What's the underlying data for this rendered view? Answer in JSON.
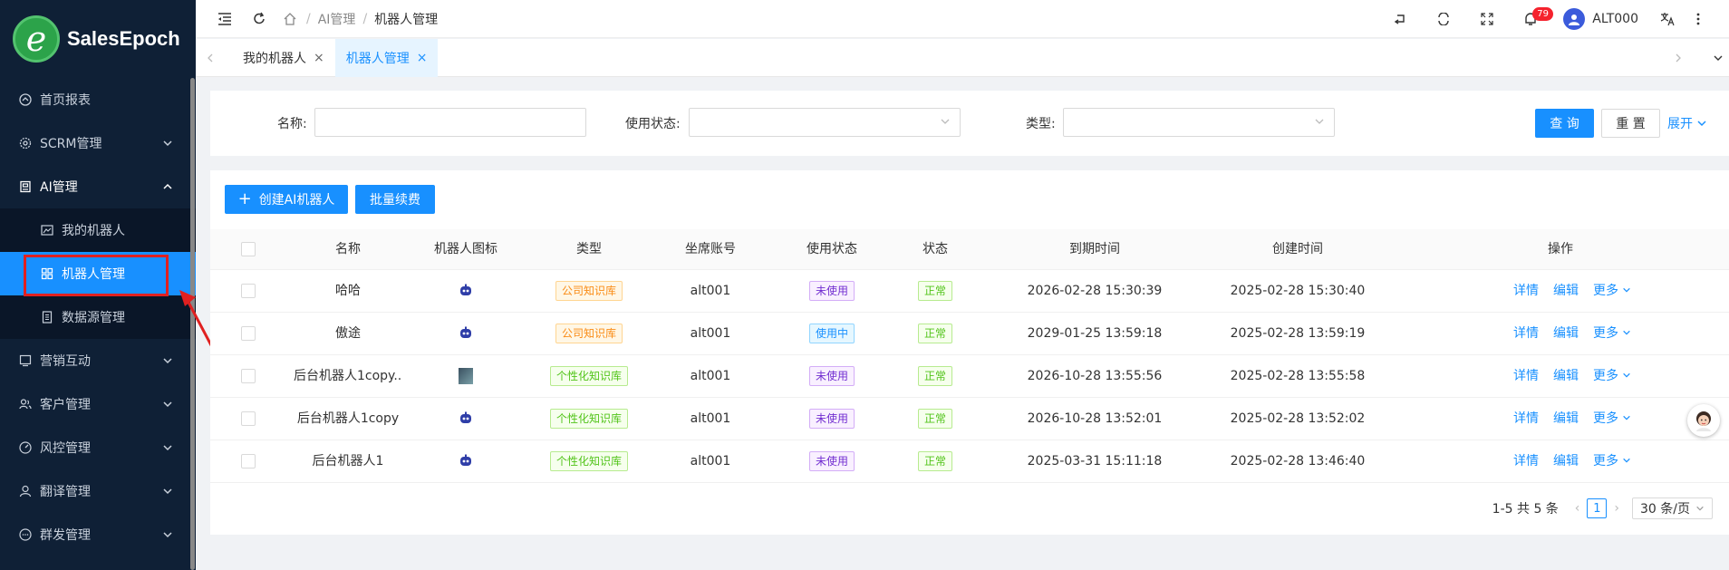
{
  "logo": {
    "letter": "e",
    "text": "SalesEpoch"
  },
  "sidebar": {
    "items": [
      {
        "label": "首页报表",
        "icon": "dashboard-icon"
      },
      {
        "label": "SCRM管理",
        "icon": "gear-icon"
      },
      {
        "label": "AI管理",
        "icon": "robot-icon"
      },
      {
        "label": "营销互动",
        "icon": "marketing-icon"
      },
      {
        "label": "客户管理",
        "icon": "users-icon"
      },
      {
        "label": "风控管理",
        "icon": "gauge-icon"
      },
      {
        "label": "翻译管理",
        "icon": "user-icon"
      },
      {
        "label": "群发管理",
        "icon": "chat-icon"
      }
    ],
    "submenu": [
      {
        "label": "我的机器人"
      },
      {
        "label": "机器人管理"
      },
      {
        "label": "数据源管理"
      }
    ]
  },
  "header": {
    "breadcrumb": [
      "AI管理",
      "机器人管理"
    ],
    "notif_count": "79",
    "username": "ALT000"
  },
  "tabs": [
    {
      "label": "我的机器人",
      "active": false
    },
    {
      "label": "机器人管理",
      "active": true
    }
  ],
  "search": {
    "name_label": "名称:",
    "status_label": "使用状态:",
    "type_label": "类型:",
    "query_button": "查 询",
    "reset_button": "重 置",
    "expand_link": "展开"
  },
  "toolbar": {
    "create_button": "创建AI机器人",
    "renew_button": "批量续费"
  },
  "table": {
    "columns": [
      "名称",
      "机器人图标",
      "类型",
      "坐席账号",
      "使用状态",
      "状态",
      "到期时间",
      "创建时间",
      "操作"
    ],
    "rows": [
      {
        "name": "哈哈",
        "icon": "robot",
        "type": "公司知识库",
        "type_color": "orange",
        "account": "alt001",
        "usage": "未使用",
        "usage_color": "purple",
        "status": "正常",
        "expire": "2026-02-28 15:30:39",
        "created": "2025-02-28 15:30:40"
      },
      {
        "name": "傲途",
        "icon": "robot",
        "type": "公司知识库",
        "type_color": "orange",
        "account": "alt001",
        "usage": "使用中",
        "usage_color": "blue",
        "status": "正常",
        "expire": "2029-01-25 13:59:18",
        "created": "2025-02-28 13:59:19"
      },
      {
        "name": "后台机器人1copy...",
        "icon": "image",
        "type": "个性化知识库",
        "type_color": "green",
        "account": "alt001",
        "usage": "未使用",
        "usage_color": "purple",
        "status": "正常",
        "expire": "2026-10-28 13:55:56",
        "created": "2025-02-28 13:55:58"
      },
      {
        "name": "后台机器人1copy",
        "icon": "robot",
        "type": "个性化知识库",
        "type_color": "green",
        "account": "alt001",
        "usage": "未使用",
        "usage_color": "purple",
        "status": "正常",
        "expire": "2026-10-28 13:52:01",
        "created": "2025-02-28 13:52:02"
      },
      {
        "name": "后台机器人1",
        "icon": "robot",
        "type": "个性化知识库",
        "type_color": "green",
        "account": "alt001",
        "usage": "未使用",
        "usage_color": "purple",
        "status": "正常",
        "expire": "2025-03-31 15:11:18",
        "created": "2025-02-28 13:46:40"
      }
    ],
    "ops": [
      "详情",
      "编辑",
      "更多"
    ]
  },
  "pagination": {
    "summary": "1-5 共 5 条",
    "current": "1",
    "page_size": "30 条/页"
  },
  "colors": {
    "primary": "#1890ff",
    "sidebar_bg": "#0f2036",
    "highlight": "#e02020"
  }
}
